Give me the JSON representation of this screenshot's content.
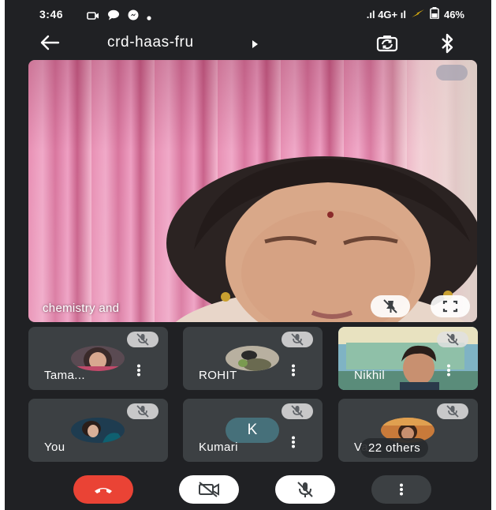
{
  "status_bar": {
    "time": "3:46",
    "network": ".ıl 4G+ ıl",
    "battery": "46%"
  },
  "top_bar": {
    "title": "crd-haas-fru"
  },
  "main_tile": {
    "name": "chemistry and"
  },
  "participants": [
    {
      "name": "Tama..."
    },
    {
      "name": "ROHIT"
    },
    {
      "name": "Nikhil"
    },
    {
      "name": "You"
    },
    {
      "name": "Kumari",
      "initial": "K"
    },
    {
      "name": "Va"
    }
  ],
  "others_pill": "22 others",
  "colors": {
    "background": "#202124",
    "tile": "#3c4043",
    "end_call": "#ea4335",
    "avatar_k": "#46707a"
  }
}
